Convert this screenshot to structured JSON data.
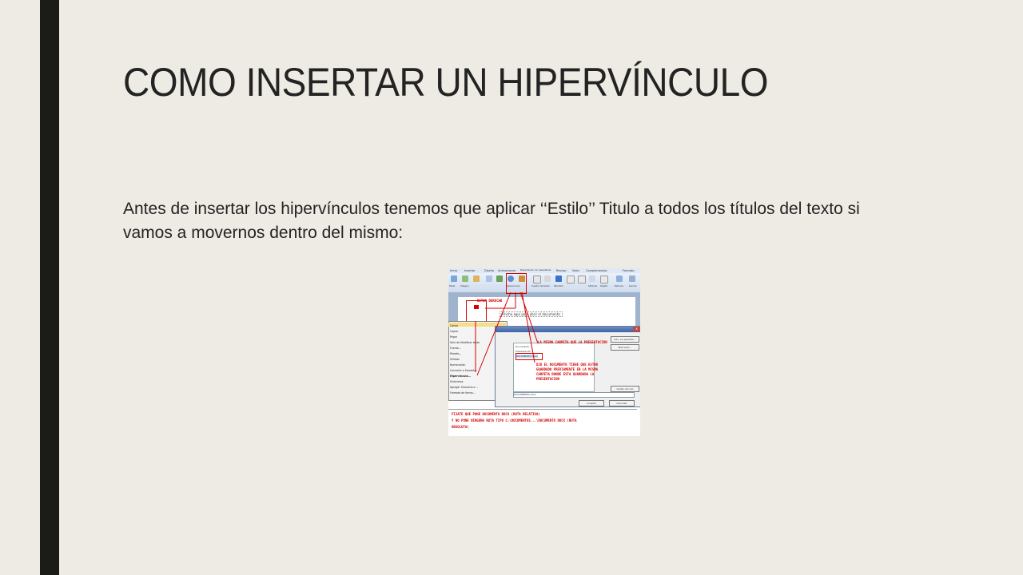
{
  "slide": {
    "title": "COMO INSERTAR UN HIPERVÍNCULO",
    "body": "Antes de insertar los hipervínculos tenemos que aplicar ‘‘Estilo’’ Titulo a todos los títulos del texto si vamos a movernos dentro del mismo:"
  },
  "colors": {
    "background": "#eeebe4",
    "left_bar": "#1b1c17",
    "text": "#232323",
    "annotation_red": "#d40000"
  },
  "screenshot": {
    "ribbon_tabs": [
      "Inicio",
      "Insertar",
      "Diseño",
      "Animaciones",
      "Presentación con diapositivas",
      "Revisar",
      "Vista",
      "Complementos",
      "Formato"
    ],
    "ribbon_buttons": [
      "Tabla",
      "Imagen",
      "Imágenes prediseñadas",
      "Álbum de fotografías",
      "Formas",
      "SmartArt",
      "Gráfico",
      "Hipervínculo",
      "Acción",
      "Cuadro de texto",
      "Encabezado y pie de página",
      "WordArt",
      "Fecha y hora",
      "Número de diapositiva",
      "Símbolo",
      "Objeto",
      "Película",
      "Sonido"
    ],
    "annotation_boton_derecho": "BOTON DERECHO",
    "doc_text": "Pinche aquí para abrir el documento",
    "context_menu": [
      "Cortar",
      "Copiar",
      "Pegar",
      "Salir de Modificar texto",
      "Fuente...",
      "Párrafo...",
      "Viñetas",
      "Numeración",
      "Convertir a SmartArt",
      "Hipervínculo...",
      "Sinónimos",
      "Agregar Sinonimo a ...",
      "Formato de forma..."
    ],
    "annotation_misma_carpeta": "LA MISMA CARPETA QUE LA PRESENTACION",
    "annotation_ojo": [
      "OJO EL DOCUMENTO TIENE QUE ESTAR",
      "GUARDADO PREVIAMENTE EN LA MISMA",
      "CARPETA DONDE ESTA GUARDADA LA",
      "PRESENTACION"
    ],
    "annotation_fijate": [
      "FIJATE QUE PONE DOCUMENTO DOCX (RUTA RELATIVA)",
      "Y NO PONE NINGUNA RUTA TIPO C:\\DOCUMENTOS...\\DOCUMENTO DOCX (RUTA",
      "ABSOLUTA)"
    ],
    "dialog_buttons": [
      "Info. en pantalla...",
      "Marcador...",
      "Quitar vínculo",
      "Aceptar",
      "Cancelar"
    ],
    "dialog_list": [
      "Documento",
      "Presentación",
      "DOCUMENTO.docx"
    ],
    "dialog_address": "DOCUMENTO.docx"
  }
}
